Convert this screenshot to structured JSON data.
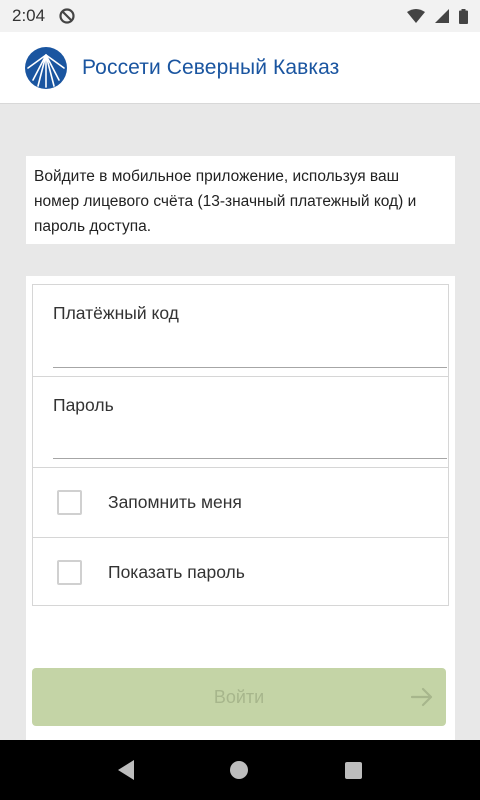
{
  "status_bar": {
    "time": "2:04",
    "icons": [
      "do-not-disturb-icon",
      "wifi-icon",
      "signal-icon",
      "battery-icon"
    ]
  },
  "header": {
    "title": "Россети Северный Кавказ",
    "logo": "rosseti-logo",
    "accent_color": "#1a55a0"
  },
  "intro": {
    "text": "Войдите в мобильное приложение, используя ваш номер лицевого счёта (13-значный платежный код) и пароль доступа."
  },
  "form": {
    "payment_code_label": "Платёжный код",
    "payment_code_value": "",
    "password_label": "Пароль",
    "password_value": "",
    "remember_label": "Запомнить меня",
    "remember_checked": false,
    "show_password_label": "Показать пароль",
    "show_password_checked": false
  },
  "login_button": {
    "label": "Войти",
    "enabled": false,
    "color": "#c4d4a6",
    "icon": "arrow-right-icon"
  },
  "nav_bar": {
    "buttons": [
      "back-icon",
      "home-icon",
      "recents-icon"
    ]
  }
}
